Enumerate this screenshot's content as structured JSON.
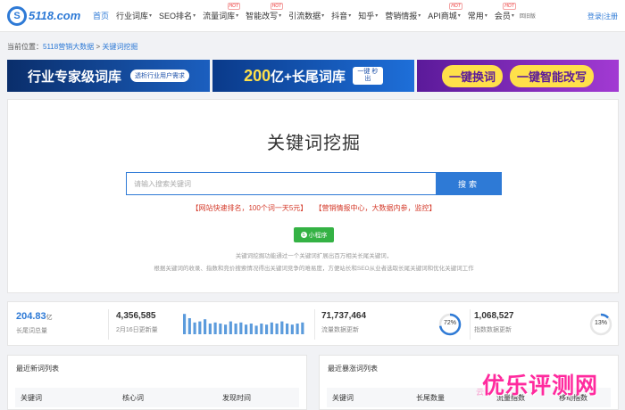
{
  "header": {
    "logo_mark": "S",
    "logo_text": "5118.com",
    "nav": [
      {
        "label": "首页",
        "active": true,
        "caret": false,
        "hot": false
      },
      {
        "label": "行业词库",
        "caret": true,
        "hot": false
      },
      {
        "label": "SEO排名",
        "caret": true,
        "hot": false
      },
      {
        "label": "流量词库",
        "caret": true,
        "hot": true
      },
      {
        "label": "智能改写",
        "caret": true,
        "hot": true
      },
      {
        "label": "引流数据",
        "caret": true,
        "hot": false
      },
      {
        "label": "抖音",
        "caret": true,
        "hot": false
      },
      {
        "label": "知乎",
        "caret": true,
        "hot": false
      },
      {
        "label": "营销情报",
        "caret": true,
        "hot": false
      },
      {
        "label": "API商城",
        "caret": true,
        "hot": true
      },
      {
        "label": "常用",
        "caret": true,
        "hot": false
      },
      {
        "label": "会员",
        "caret": true,
        "hot": true
      }
    ],
    "hot_label": "HOT",
    "caret_glyph": "▾",
    "back_old": "回旧版",
    "login": "登录|注册"
  },
  "breadcrumb": {
    "prefix": "当前位置：",
    "home": "5118营销大数据",
    "sep": ">",
    "current": "关键词挖掘"
  },
  "banners": {
    "b1_title": "行业专家级词库",
    "b1_sub": "透析行业用户需求",
    "b2_num": "200",
    "b2_text": "亿+长尾词库",
    "b2_btn": "一键 秒出",
    "b3_left": "一键换词",
    "b3_right": "一键智能改写"
  },
  "main": {
    "title": "关键词挖掘",
    "search_placeholder": "请输入搜索关键词",
    "search_button": "搜索",
    "promo1": "【网站快速排名，100个词一天5元】",
    "promo2": "【营销情报中心，大数据内参，监控】",
    "mini_program": "小程序",
    "desc1": "关键词挖掘功能通过一个关键词扩展出百万相关长尾关键词，",
    "desc2": "根据关键词的收录、指数和竞价搜索情况得出关键词竞争的难易度，方便站长和SEO从业者选取长尾关键词和优化关键词工作"
  },
  "stats": {
    "total_value": "204.83",
    "total_unit": "亿",
    "total_label": "长尾词总量",
    "daily_value": "4,356,585",
    "daily_label": "2月16日更新量",
    "traffic_value": "71,737,464",
    "traffic_label": "流量数据更新",
    "traffic_pct": 72,
    "traffic_pct_label": "72%",
    "index_value": "1,068,527",
    "index_label": "指数数据更新",
    "index_pct": 13,
    "index_pct_label": "13%",
    "bars": [
      0.95,
      0.75,
      0.55,
      0.6,
      0.7,
      0.5,
      0.55,
      0.5,
      0.45,
      0.6,
      0.5,
      0.55,
      0.45,
      0.5,
      0.4,
      0.5,
      0.45,
      0.55,
      0.5,
      0.6,
      0.5,
      0.45,
      0.5,
      0.55
    ],
    "bar_color": "#5b9bdc",
    "ring_color": "#2e7ad6",
    "ring_track": "#e6e6e6"
  },
  "panels": {
    "new_title": "最近新词列表",
    "new_cols": [
      "关键词",
      "核心词",
      "发现时间"
    ],
    "rise_title": "最近暴涨词列表",
    "rise_cols": [
      "关键词",
      "长尾数量",
      "流量指数",
      "移动指数"
    ]
  },
  "watermark": {
    "main": "优乐评测网",
    "sub": "云"
  }
}
